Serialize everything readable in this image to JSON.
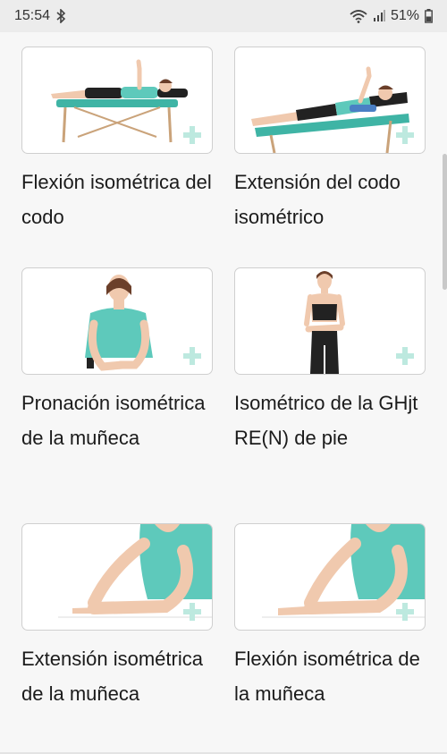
{
  "status_bar": {
    "time": "15:54",
    "battery": "51%"
  },
  "exercises": [
    {
      "title": "Flexión isométrica del codo"
    },
    {
      "title": "Extensión del codo isométrico"
    },
    {
      "title": "Pronación isométrica de la muñeca"
    },
    {
      "title": "Isométrico de la GHjt RE(N) de pie"
    },
    {
      "title": "Extensión isométrica de la muñeca"
    },
    {
      "title": "Flexión isométrica de la muñeca"
    }
  ],
  "icons": {
    "bluetooth": "bluetooth-icon",
    "wifi": "wifi-icon",
    "signal": "signal-icon",
    "battery": "battery-icon",
    "card_mark": "plus-watermark-icon"
  },
  "colors": {
    "accent_teal": "#3fb4a5",
    "watermark": "#bde9df"
  }
}
